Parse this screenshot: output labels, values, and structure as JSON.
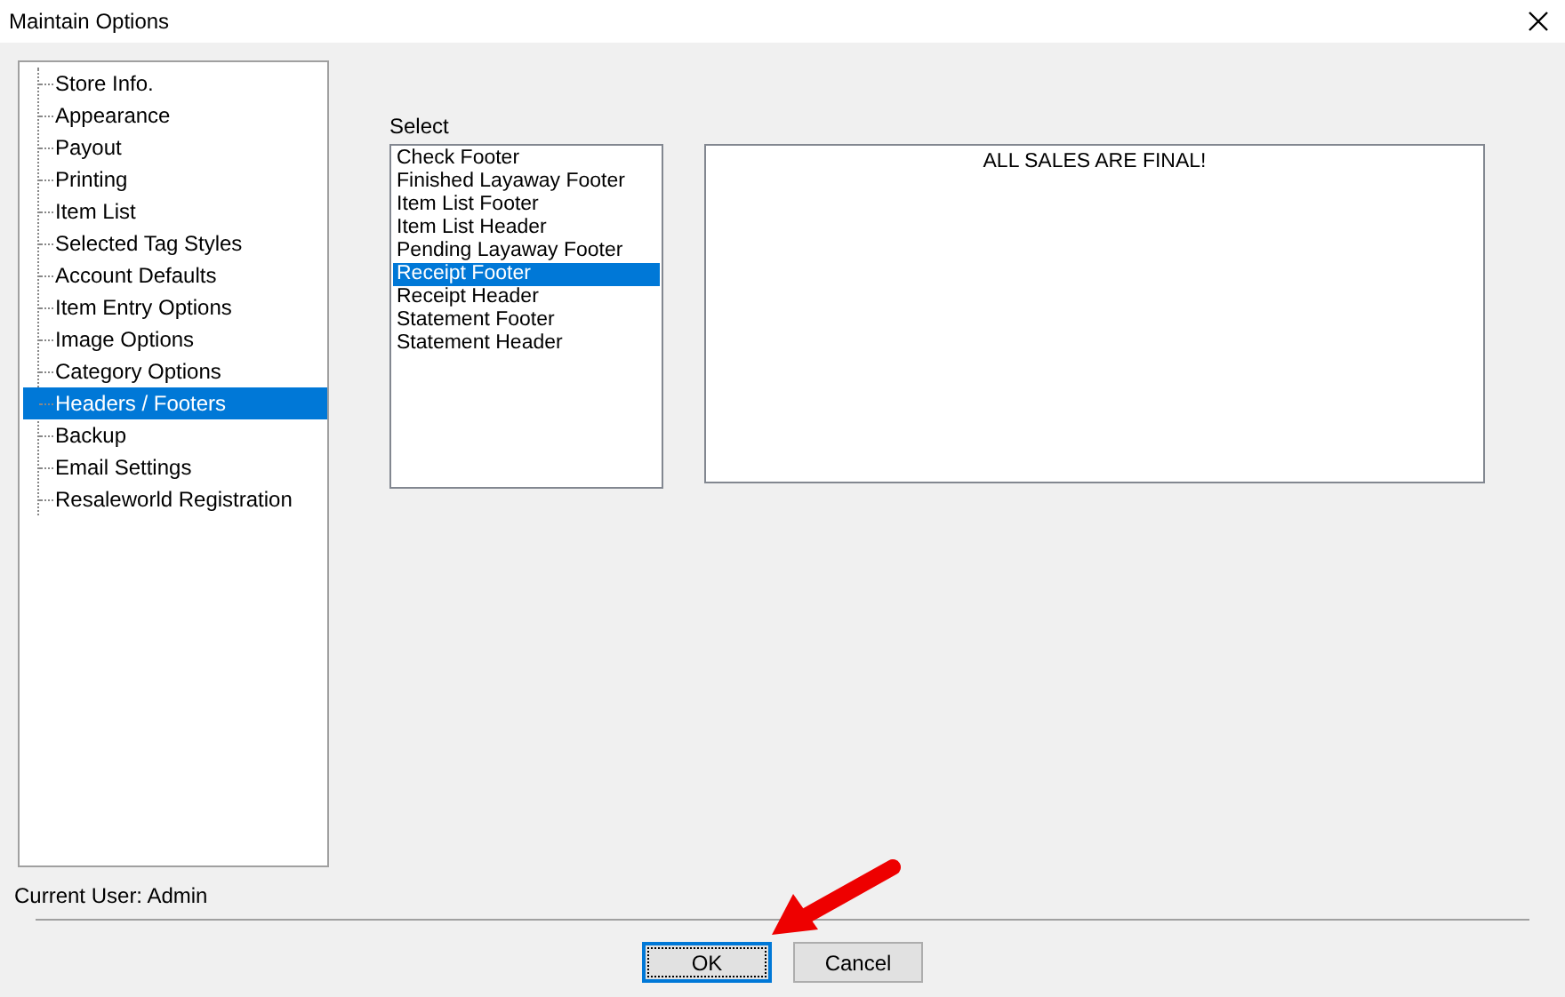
{
  "window": {
    "title": "Maintain Options"
  },
  "tree": {
    "items": [
      {
        "label": "Store Info.",
        "selected": false
      },
      {
        "label": "Appearance",
        "selected": false
      },
      {
        "label": "Payout",
        "selected": false
      },
      {
        "label": "Printing",
        "selected": false
      },
      {
        "label": "Item List",
        "selected": false
      },
      {
        "label": "Selected Tag Styles",
        "selected": false
      },
      {
        "label": "Account Defaults",
        "selected": false
      },
      {
        "label": "Item Entry Options",
        "selected": false
      },
      {
        "label": "Image Options",
        "selected": false
      },
      {
        "label": "Category Options",
        "selected": false
      },
      {
        "label": "Headers / Footers",
        "selected": true
      },
      {
        "label": "Backup",
        "selected": false
      },
      {
        "label": "Email Settings",
        "selected": false
      },
      {
        "label": "Resaleworld Registration",
        "selected": false
      }
    ]
  },
  "select": {
    "label": "Select",
    "items": [
      {
        "label": "Check Footer",
        "selected": false
      },
      {
        "label": "Finished Layaway Footer",
        "selected": false
      },
      {
        "label": "Item List Footer",
        "selected": false
      },
      {
        "label": "Item List Header",
        "selected": false
      },
      {
        "label": "Pending Layaway Footer",
        "selected": false
      },
      {
        "label": "Receipt Footer",
        "selected": true
      },
      {
        "label": "Receipt Header",
        "selected": false
      },
      {
        "label": "Statement Footer",
        "selected": false
      },
      {
        "label": "Statement Header",
        "selected": false
      }
    ]
  },
  "text_area": {
    "value": "ALL SALES ARE FINAL!"
  },
  "status": {
    "current_user": "Current User: Admin"
  },
  "buttons": [
    {
      "label": "OK",
      "focused": true
    },
    {
      "label": "Cancel",
      "focused": false
    }
  ]
}
